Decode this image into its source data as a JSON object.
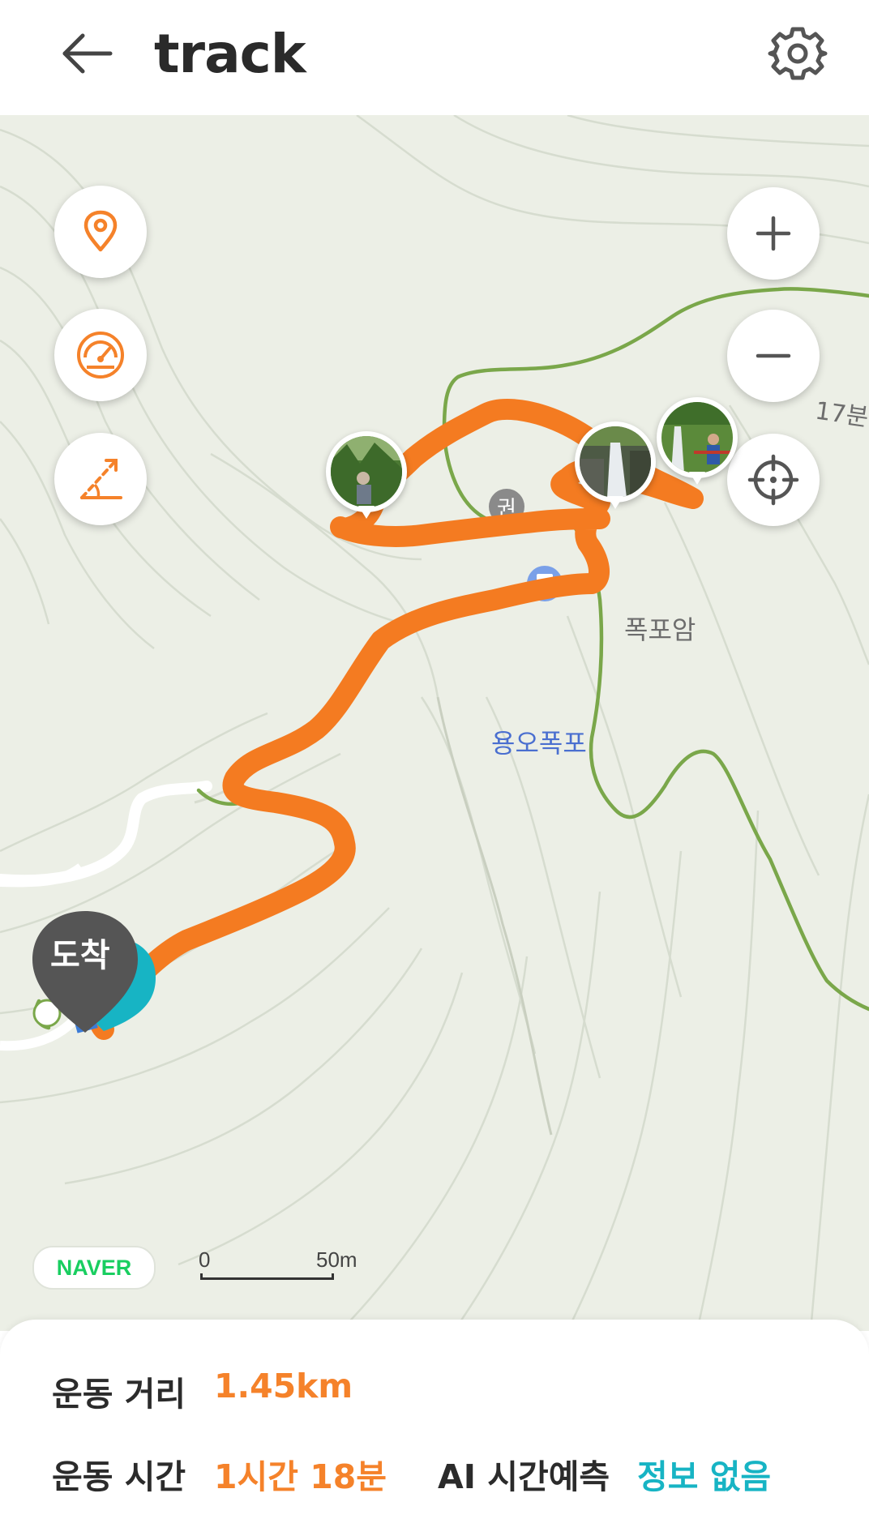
{
  "header": {
    "title": "track"
  },
  "map": {
    "labels": {
      "trail_time": "17분",
      "waterfall_rock": "폭포암",
      "waterfall_poi": "용오폭포"
    },
    "arrival_marker_label": "도착",
    "provider_logo": "NAVER",
    "scale": {
      "start": "0",
      "end": "50m"
    },
    "controls": [
      {
        "name": "location-pin-icon"
      },
      {
        "name": "speedometer-icon"
      },
      {
        "name": "elevation-slope-icon"
      },
      {
        "name": "zoom-in-icon"
      },
      {
        "name": "zoom-out-icon"
      },
      {
        "name": "my-location-crosshair-icon"
      }
    ],
    "photo_markers": 3
  },
  "stats": {
    "distance_label": "운동 거리",
    "distance_value": "1.45km",
    "duration_label": "운동 시간",
    "duration_value": "1시간 18분",
    "ai_label": "AI 시간예측",
    "ai_value": "정보 없음"
  },
  "colors": {
    "accent_orange": "#f5822a",
    "teal": "#17b4c4",
    "trail_green": "#7aa74a",
    "naver_green": "#19ce60"
  }
}
